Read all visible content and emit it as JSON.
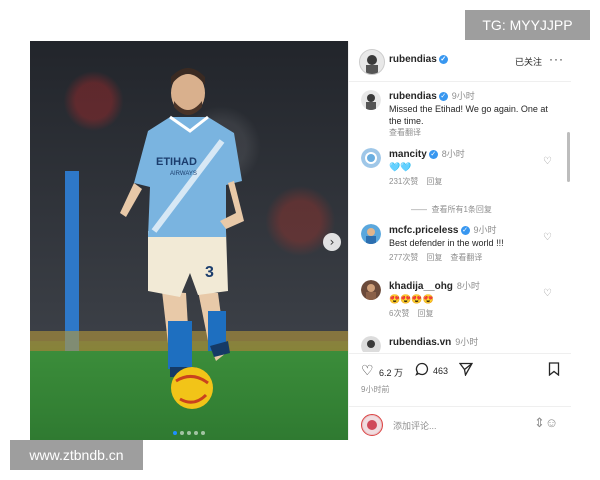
{
  "watermarks": {
    "top": "TG: MYYJJPP",
    "bottom": "www.ztbndb.cn"
  },
  "photo": {
    "shirt_sponsor": "ETIHAD",
    "shirt_sponsor_sub": "AIRWAYS",
    "shirt_number": "3",
    "slide_count": 5,
    "current_slide": 1
  },
  "header": {
    "username": "rubendias",
    "follow_label": "已关注",
    "more": "···"
  },
  "caption": {
    "username": "rubendias",
    "time": "9小时",
    "text": "Missed the Etihad! We go again. One at the time.",
    "translate": "查看翻译"
  },
  "comments": [
    {
      "username": "mancity",
      "verified": true,
      "time": "8小时",
      "text": "🩵🩵",
      "likes": "231次赞",
      "reply": "回复",
      "view_replies": "查看所有1条回复"
    },
    {
      "username": "mcfc.priceless",
      "verified": true,
      "time": "9小时",
      "text": "Best defender in the world !!!",
      "likes": "277次赞",
      "reply": "回复",
      "translate": "查看翻译"
    },
    {
      "username": "khadija__ohg",
      "verified": false,
      "time": "8小时",
      "text": "😍😍😍😍",
      "likes": "6次赞",
      "reply": "回复"
    },
    {
      "username": "rubendias.vn",
      "verified": false,
      "time": "9小时",
      "text": ""
    }
  ],
  "actions": {
    "likes_count": "6.2 万",
    "comments_count": "463",
    "post_time": "9小时前"
  },
  "add_comment": {
    "placeholder": "添加评论..."
  }
}
